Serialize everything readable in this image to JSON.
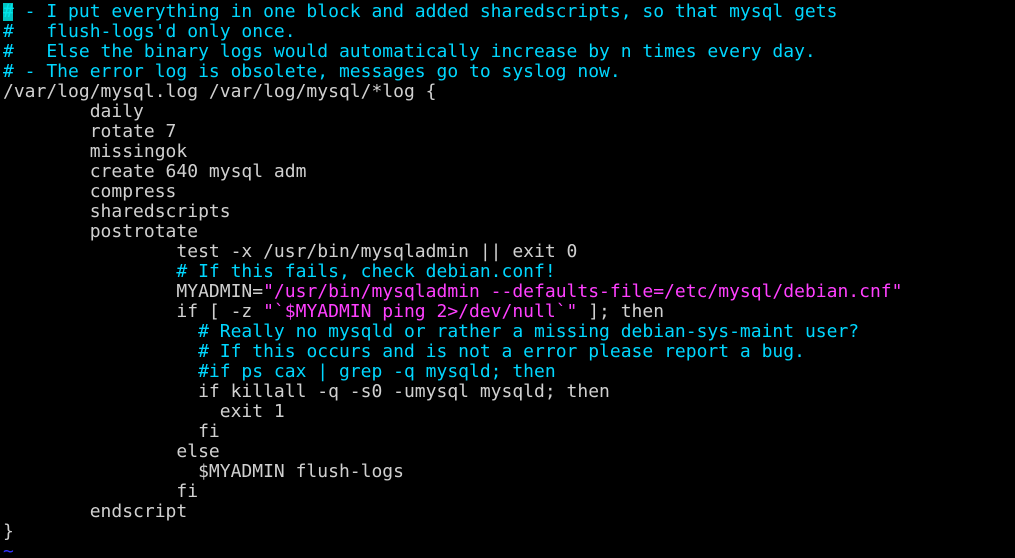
{
  "editor": {
    "name": "vim",
    "colors": {
      "background": "#000000",
      "comment": "#00d7ff",
      "text": "#d0d0d0",
      "string": "#ff40ff",
      "tilde": "#3333ff",
      "cursor": "#00e5e5"
    },
    "cursor": {
      "line": 1,
      "column": 1
    },
    "lines": [
      {
        "segments": [
          {
            "text": "# - I put everything in one block and added sharedscripts, so that mysql gets",
            "style": "comment"
          }
        ]
      },
      {
        "segments": [
          {
            "text": "#   flush-logs'd only once.",
            "style": "comment"
          }
        ]
      },
      {
        "segments": [
          {
            "text": "#   Else the binary logs would automatically increase by n times every day.",
            "style": "comment"
          }
        ]
      },
      {
        "segments": [
          {
            "text": "# - The error log is obsolete, messages go to syslog now.",
            "style": "comment"
          }
        ]
      },
      {
        "segments": [
          {
            "text": "/var/log/mysql.log /var/log/mysql/*log {",
            "style": "text"
          }
        ]
      },
      {
        "segments": [
          {
            "text": "        daily",
            "style": "text"
          }
        ]
      },
      {
        "segments": [
          {
            "text": "        rotate 7",
            "style": "text"
          }
        ]
      },
      {
        "segments": [
          {
            "text": "        missingok",
            "style": "text"
          }
        ]
      },
      {
        "segments": [
          {
            "text": "        create 640 mysql adm",
            "style": "text"
          }
        ]
      },
      {
        "segments": [
          {
            "text": "        compress",
            "style": "text"
          }
        ]
      },
      {
        "segments": [
          {
            "text": "        sharedscripts",
            "style": "text"
          }
        ]
      },
      {
        "segments": [
          {
            "text": "        postrotate",
            "style": "text"
          }
        ]
      },
      {
        "segments": [
          {
            "text": "                test -x /usr/bin/mysqladmin || exit 0",
            "style": "text"
          }
        ]
      },
      {
        "segments": [
          {
            "text": "                ",
            "style": "text"
          },
          {
            "text": "# If this fails, check debian.conf!",
            "style": "comment"
          }
        ]
      },
      {
        "segments": [
          {
            "text": "                MYADMIN=",
            "style": "text"
          },
          {
            "text": "\"/usr/bin/mysqladmin --defaults-file=/etc/mysql/debian.cnf\"",
            "style": "string"
          }
        ]
      },
      {
        "segments": [
          {
            "text": "                if [ -z ",
            "style": "text"
          },
          {
            "text": "\"`$MYADMIN ping 2>/dev/null`\"",
            "style": "string"
          },
          {
            "text": " ]; then",
            "style": "text"
          }
        ]
      },
      {
        "segments": [
          {
            "text": "                  ",
            "style": "text"
          },
          {
            "text": "# Really no mysqld or rather a missing debian-sys-maint user?",
            "style": "comment"
          }
        ]
      },
      {
        "segments": [
          {
            "text": "                  ",
            "style": "text"
          },
          {
            "text": "# If this occurs and is not a error please report a bug.",
            "style": "comment"
          }
        ]
      },
      {
        "segments": [
          {
            "text": "                  ",
            "style": "text"
          },
          {
            "text": "#if ps cax | grep -q mysqld; then",
            "style": "comment"
          }
        ]
      },
      {
        "segments": [
          {
            "text": "                  if killall -q -s0 -umysql mysqld; then",
            "style": "text"
          }
        ]
      },
      {
        "segments": [
          {
            "text": "                    exit 1",
            "style": "text"
          }
        ]
      },
      {
        "segments": [
          {
            "text": "                  fi",
            "style": "text"
          }
        ]
      },
      {
        "segments": [
          {
            "text": "                else",
            "style": "text"
          }
        ]
      },
      {
        "segments": [
          {
            "text": "                  $MYADMIN flush-logs",
            "style": "text"
          }
        ]
      },
      {
        "segments": [
          {
            "text": "                fi",
            "style": "text"
          }
        ]
      },
      {
        "segments": [
          {
            "text": "        endscript",
            "style": "text"
          }
        ]
      },
      {
        "segments": [
          {
            "text": "}",
            "style": "text"
          }
        ]
      },
      {
        "segments": [
          {
            "text": "~",
            "style": "tilde"
          }
        ]
      }
    ]
  }
}
